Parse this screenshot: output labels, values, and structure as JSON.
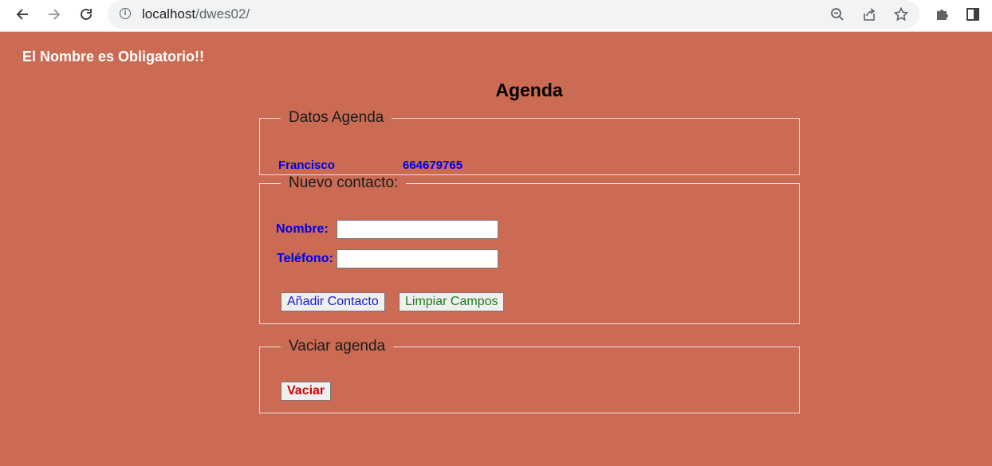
{
  "browser": {
    "url_host": "localhost",
    "url_path": "/dwes02/"
  },
  "page": {
    "error_message": "El Nombre es Obligatorio!!",
    "title": "Agenda"
  },
  "datos_agenda": {
    "legend": "Datos Agenda",
    "contacts": [
      {
        "name": "Francisco",
        "phone": "664679765"
      }
    ]
  },
  "nuevo_contacto": {
    "legend": "Nuevo contacto:",
    "nombre_label": "Nombre:",
    "nombre_value": "",
    "telefono_label": "Teléfono:",
    "telefono_value": "",
    "add_button": "Añadir Contacto",
    "clear_button": "Limpiar Campos"
  },
  "vaciar_agenda": {
    "legend": "Vaciar agenda",
    "empty_button": "Vaciar"
  },
  "colors": {
    "background": "#cb6b54",
    "label_blue": "#0000ee",
    "add_button_text": "#1a1acc",
    "clear_button_text": "#1e7a1e",
    "empty_button_text": "#cc0000"
  }
}
